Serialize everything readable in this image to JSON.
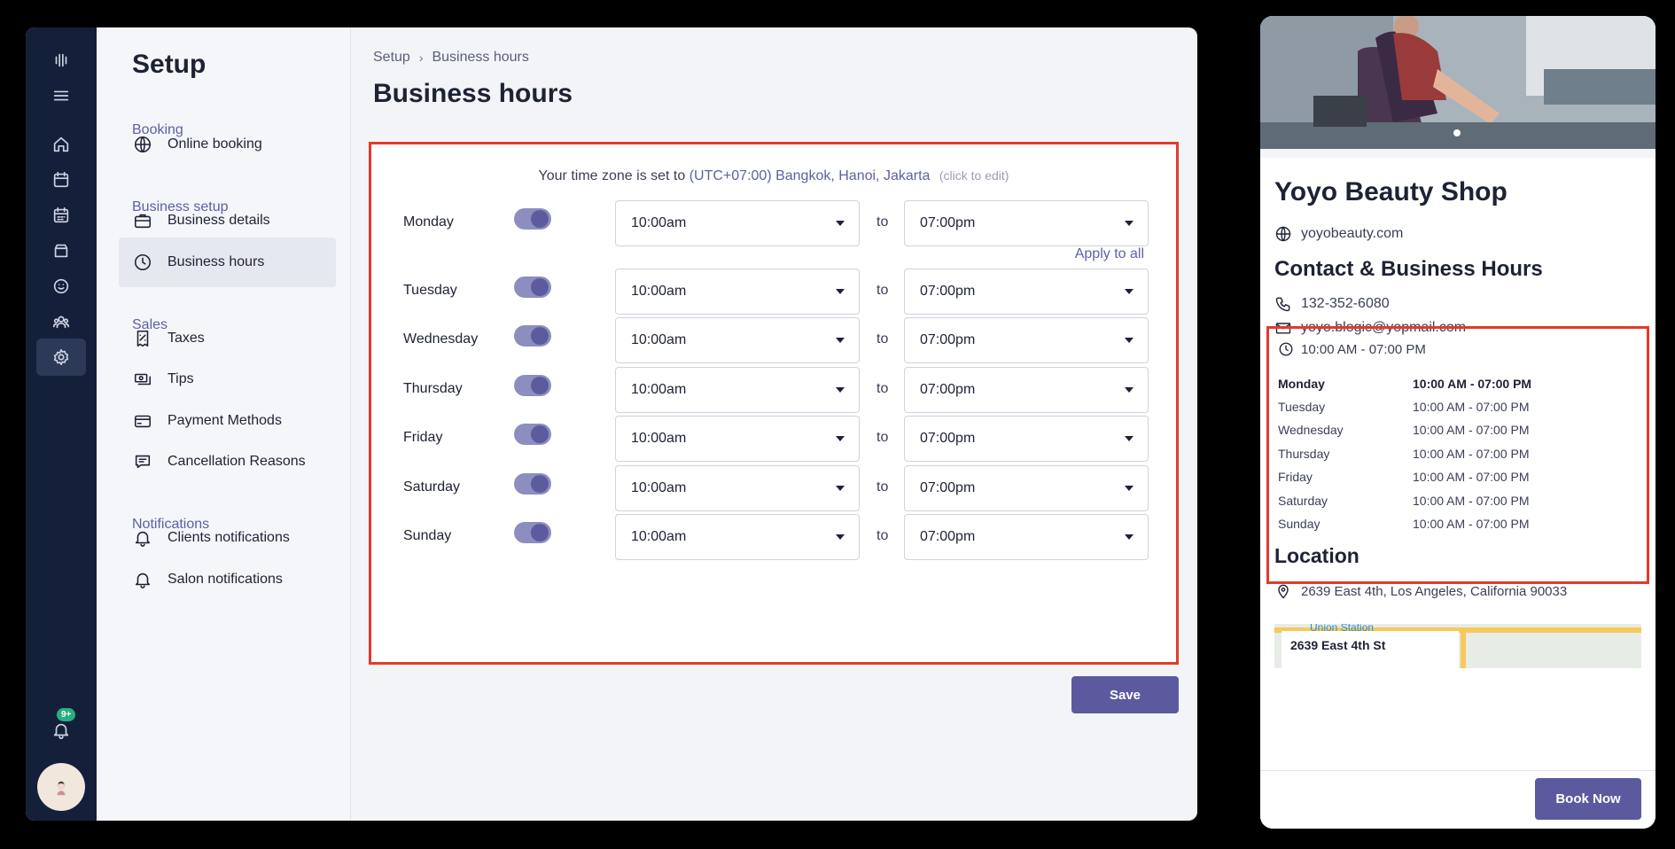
{
  "setup": {
    "title": "Setup",
    "sections": [
      {
        "label": "Booking",
        "items": [
          {
            "label": "Online booking",
            "icon": "globe-icon"
          }
        ]
      },
      {
        "label": "Business setup",
        "items": [
          {
            "label": "Business details",
            "icon": "briefcase-icon"
          },
          {
            "label": "Business hours",
            "icon": "clock-icon",
            "active": true
          }
        ]
      },
      {
        "label": "Sales",
        "items": [
          {
            "label": "Taxes",
            "icon": "receipt-icon"
          },
          {
            "label": "Tips",
            "icon": "cash-icon"
          },
          {
            "label": "Payment Methods",
            "icon": "card-icon"
          },
          {
            "label": "Cancellation Reasons",
            "icon": "chat-icon"
          }
        ]
      },
      {
        "label": "Notifications",
        "items": [
          {
            "label": "Clients notifications",
            "icon": "bell-icon"
          },
          {
            "label": "Salon notifications",
            "icon": "bell-icon"
          }
        ]
      }
    ]
  },
  "iconbar": {
    "icons": [
      "logo-icon",
      "menu-icon",
      "home-icon",
      "calendar-icon",
      "schedule-icon",
      "inventory-icon",
      "smile-icon",
      "clients-icon",
      "settings-icon"
    ],
    "notification_badge": "9+"
  },
  "content": {
    "breadcrumb": [
      "Setup",
      "Business hours"
    ],
    "title": "Business hours",
    "timezone": {
      "prefix": "Your time zone is set to",
      "value": "(UTC+07:00) Bangkok, Hanoi, Jakarta",
      "hint": "(click to edit)"
    },
    "apply_all": "Apply to all",
    "to_label": "to",
    "days": [
      {
        "day": "Monday",
        "enabled": true,
        "from": "10:00am",
        "to": "07:00pm"
      },
      {
        "day": "Tuesday",
        "enabled": true,
        "from": "10:00am",
        "to": "07:00pm"
      },
      {
        "day": "Wednesday",
        "enabled": true,
        "from": "10:00am",
        "to": "07:00pm"
      },
      {
        "day": "Thursday",
        "enabled": true,
        "from": "10:00am",
        "to": "07:00pm"
      },
      {
        "day": "Friday",
        "enabled": true,
        "from": "10:00am",
        "to": "07:00pm"
      },
      {
        "day": "Saturday",
        "enabled": true,
        "from": "10:00am",
        "to": "07:00pm"
      },
      {
        "day": "Sunday",
        "enabled": true,
        "from": "10:00am",
        "to": "07:00pm"
      }
    ],
    "save_label": "Save"
  },
  "phone": {
    "shop_name": "Yoyo Beauty Shop",
    "website": "yoyobeauty.com",
    "contact_heading": "Contact & Business Hours",
    "phone": "132-352-6080",
    "email": "yoyo.blogic@yopmail.com",
    "hours_summary": "10:00 AM - 07:00 PM",
    "hours": [
      {
        "day": "Monday",
        "hours": "10:00 AM - 07:00 PM",
        "today": true
      },
      {
        "day": "Tuesday",
        "hours": "10:00 AM - 07:00 PM"
      },
      {
        "day": "Wednesday",
        "hours": "10:00 AM - 07:00 PM"
      },
      {
        "day": "Thursday",
        "hours": "10:00 AM - 07:00 PM"
      },
      {
        "day": "Friday",
        "hours": "10:00 AM - 07:00 PM"
      },
      {
        "day": "Saturday",
        "hours": "10:00 AM - 07:00 PM"
      },
      {
        "day": "Sunday",
        "hours": "10:00 AM - 07:00 PM"
      }
    ],
    "location_heading": "Location",
    "address": "2639 East 4th, Los Angeles, California 90033",
    "map_card": "2639 East 4th St",
    "map_station": "Union Station",
    "book_label": "Book Now"
  },
  "colors": {
    "accent": "#5b5a9f",
    "highlight_border": "#e33b2b",
    "sidebar_bg": "#14203a"
  }
}
